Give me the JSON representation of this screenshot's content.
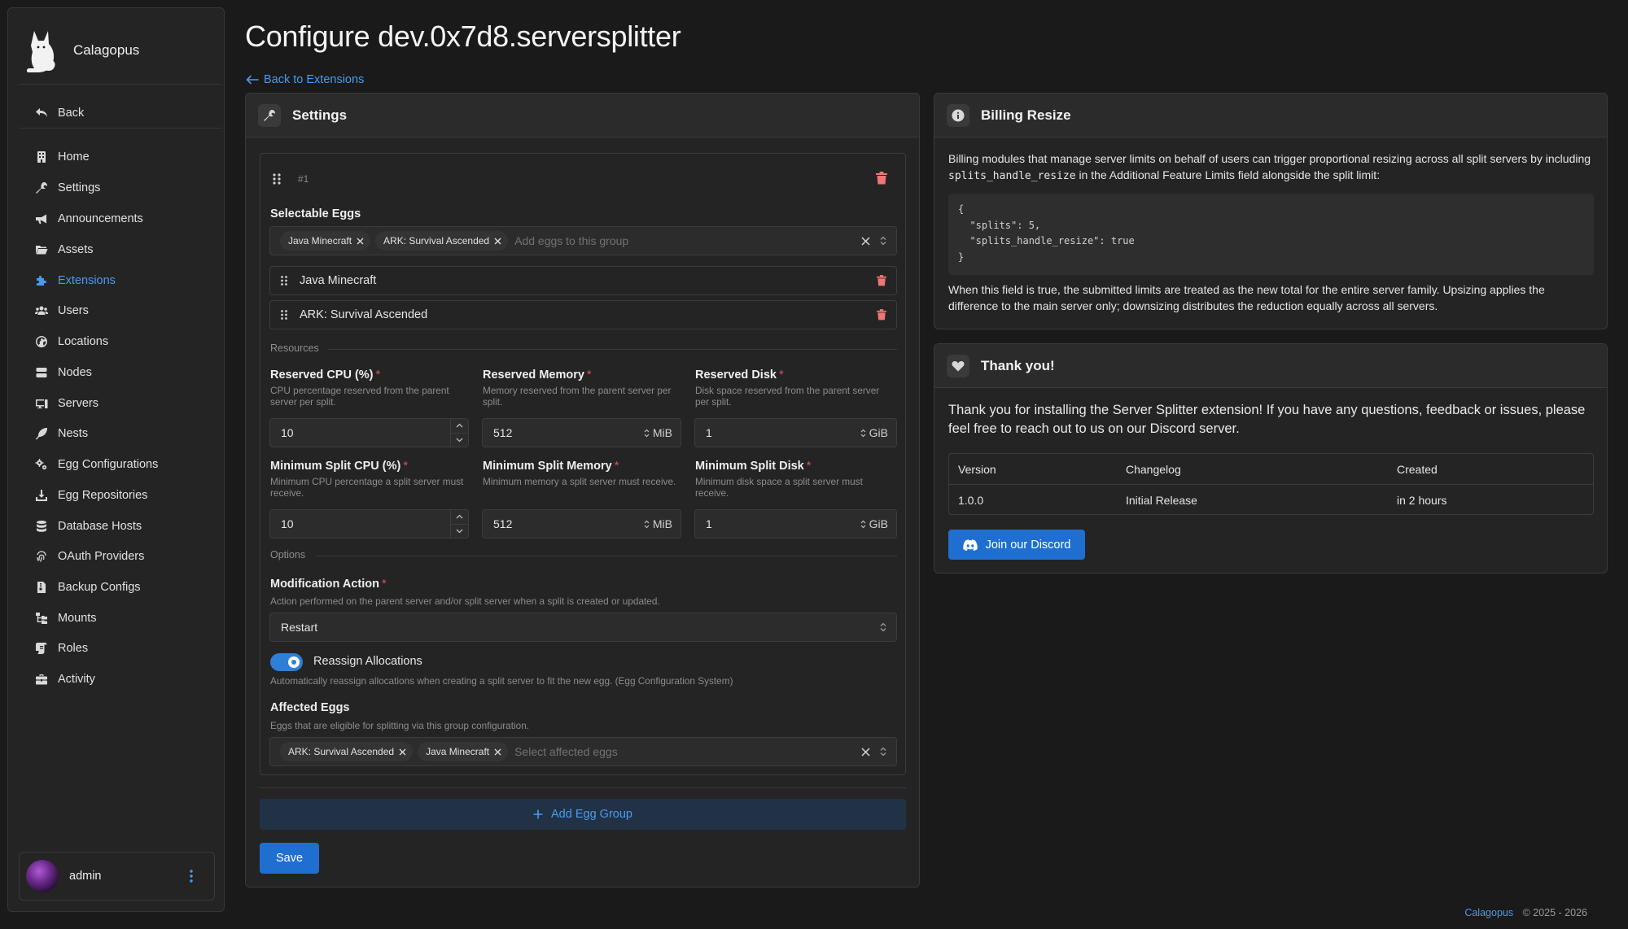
{
  "brand": {
    "name": "Calagopus"
  },
  "sidebar": {
    "back_label": "Back",
    "items": [
      {
        "label": "Home",
        "icon": "home-icon"
      },
      {
        "label": "Settings",
        "icon": "wrench-icon"
      },
      {
        "label": "Announcements",
        "icon": "megaphone-icon"
      },
      {
        "label": "Assets",
        "icon": "folder-icon"
      },
      {
        "label": "Extensions",
        "icon": "puzzle-icon",
        "active": true
      },
      {
        "label": "Users",
        "icon": "users-icon"
      },
      {
        "label": "Locations",
        "icon": "globe-icon"
      },
      {
        "label": "Nodes",
        "icon": "server-icon"
      },
      {
        "label": "Servers",
        "icon": "computer-icon"
      },
      {
        "label": "Nests",
        "icon": "feather-icon"
      },
      {
        "label": "Egg Configurations",
        "icon": "cogs-icon"
      },
      {
        "label": "Egg Repositories",
        "icon": "download-icon"
      },
      {
        "label": "Database Hosts",
        "icon": "database-icon"
      },
      {
        "label": "OAuth Providers",
        "icon": "fingerprint-icon"
      },
      {
        "label": "Backup Configs",
        "icon": "file-archive-icon"
      },
      {
        "label": "Mounts",
        "icon": "folder-tree-icon"
      },
      {
        "label": "Roles",
        "icon": "scroll-icon"
      },
      {
        "label": "Activity",
        "icon": "briefcase-icon"
      }
    ]
  },
  "user": {
    "name": "admin"
  },
  "page": {
    "title": "Configure dev.0x7d8.serversplitter",
    "back_link": "Back to Extensions"
  },
  "settings": {
    "title": "Settings",
    "group": {
      "index": "#1",
      "selectable_eggs_label": "Selectable Eggs",
      "selectable_eggs": [
        "Java Minecraft",
        "ARK: Survival Ascended"
      ],
      "selectable_eggs_placeholder": "Add eggs to this group",
      "egg_list": [
        "Java Minecraft",
        "ARK: Survival Ascended"
      ],
      "resources_title": "Resources",
      "fields": [
        {
          "label": "Reserved CPU (%)",
          "desc": "CPU percentage reserved from the parent server per split.",
          "value": "10",
          "unit": ""
        },
        {
          "label": "Reserved Memory",
          "desc": "Memory reserved from the parent server per split.",
          "value": "512",
          "unit": "MiB"
        },
        {
          "label": "Reserved Disk",
          "desc": "Disk space reserved from the parent server per split.",
          "value": "1",
          "unit": "GiB"
        },
        {
          "label": "Minimum Split CPU (%)",
          "desc": "Minimum CPU percentage a split server must receive.",
          "value": "10",
          "unit": ""
        },
        {
          "label": "Minimum Split Memory",
          "desc": "Minimum memory a split server must receive.",
          "value": "512",
          "unit": "MiB"
        },
        {
          "label": "Minimum Split Disk",
          "desc": "Minimum disk space a split server must receive.",
          "value": "1",
          "unit": "GiB"
        }
      ],
      "options_title": "Options",
      "modification_action_label": "Modification Action",
      "modification_action_desc": "Action performed on the parent server and/or split server when a split is created or updated.",
      "modification_action_value": "Restart",
      "reassign_label": "Reassign Allocations",
      "reassign_on": true,
      "reassign_desc": "Automatically reassign allocations when creating a split server to fit the new egg. (Egg Configuration System)",
      "affected_eggs_label": "Affected Eggs",
      "affected_eggs_desc": "Eggs that are eligible for splitting via this group configuration.",
      "affected_eggs": [
        "ARK: Survival Ascended",
        "Java Minecraft"
      ],
      "affected_eggs_placeholder": "Select affected eggs"
    },
    "add_group_label": "Add Egg Group",
    "save_label": "Save"
  },
  "billing": {
    "title": "Billing Resize",
    "intro_before": "Billing modules that manage server limits on behalf of users can trigger proportional resizing across all split servers by including",
    "intro_code": "splits_handle_resize",
    "intro_after": "in the Additional Feature Limits field alongside the split limit:",
    "code_lines": [
      "{",
      "  \"splits\": 5,",
      "  \"splits_handle_resize\": true",
      "}"
    ],
    "outro": "When this field is true, the submitted limits are treated as the new total for the entire server family. Upsizing applies the difference to the main server only; downsizing distributes the reduction equally across all servers."
  },
  "thanks": {
    "title": "Thank you!",
    "text": "Thank you for installing the Server Splitter extension! If you have any questions, feedback or issues, please feel free to reach out to us on our Discord server.",
    "columns": [
      "Version",
      "Changelog",
      "Created"
    ],
    "rows": [
      [
        "1.0.0",
        "Initial Release",
        "in 2 hours"
      ]
    ],
    "discord_label": "Join our Discord"
  },
  "footer": {
    "brand": "Calagopus",
    "copyright": "© 2025 - 2026"
  },
  "colors": {
    "accent": "#4a9bf0",
    "primary": "#1f6fd1",
    "danger": "#f07575",
    "background": "#1a1a1a",
    "panel": "#242424"
  }
}
